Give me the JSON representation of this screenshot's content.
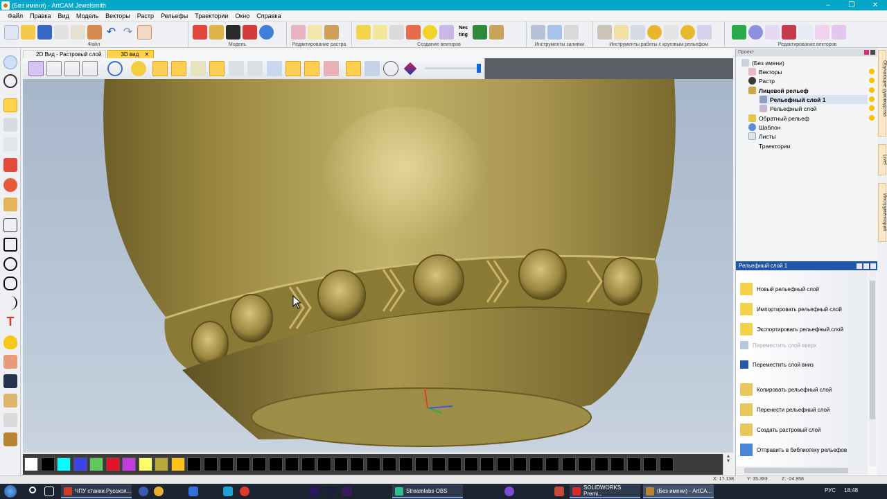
{
  "window": {
    "title": "(Без имени) - ArtCAM Jewelsmith",
    "minimize": "–",
    "maximize": "❐",
    "close": "✕"
  },
  "menu": [
    "Файл",
    "Правка",
    "Вид",
    "Модель",
    "Векторы",
    "Растр",
    "Рельефы",
    "Траектории",
    "Окно",
    "Справка"
  ],
  "ribbon": {
    "groups": [
      "Файл",
      "Модель",
      "Редактирование растра",
      "Создание векторов",
      "Инструменты заливки",
      "Инструменты работы с круговым рельефом",
      "Редактирование векторов"
    ]
  },
  "tabs": {
    "tab_2d": "2D Вид - Растровый слой",
    "tab_3d": "3D вид",
    "close": "✕"
  },
  "project": {
    "header": "Проект",
    "root": "(Без имени)",
    "vectors": "Векторы",
    "raster": "Растр",
    "face_relief": "Лицевой рельеф",
    "relief_layer_1": "Рельефный слой 1",
    "relief_layer": "Рельефный слой",
    "back_relief": "Обратный рельеф",
    "template": "Шаблон",
    "sheets": "Листы",
    "toolpaths": "Траектории"
  },
  "layer_panel": {
    "title": "Рельефный слой 1",
    "items": [
      "Новый рельефный слой",
      "Импортировать рельефный слой",
      "Экспортировать рельефный слой",
      "Переместить слой вверх",
      "Переместить слой вниз",
      "Копировать рельефный слой",
      "Перенести рельефный слой",
      "Создать растровый слой",
      "Отправить в библиотеку рельефов"
    ]
  },
  "side_tabs": [
    "Обучающие руководства",
    "Live!",
    "Инструментарий"
  ],
  "status": {
    "x": "X: 17.138",
    "y": "Y: 35.393",
    "z": "Z: -24.958"
  },
  "palette": [
    "#ffffff",
    "#000000",
    "#00ffff",
    "#3a44e6",
    "#5fc85a",
    "#e0152b",
    "#c43be0",
    "#ffff6a",
    "#b7a93c",
    "#ffc21a",
    "#000000",
    "#000000",
    "#000000",
    "#000000",
    "#000000",
    "#000000",
    "#000000",
    "#000000",
    "#000000",
    "#000000",
    "#000000",
    "#000000",
    "#000000",
    "#000000",
    "#000000",
    "#000000",
    "#000000",
    "#000000",
    "#000000",
    "#000000",
    "#000000",
    "#000000",
    "#000000",
    "#000000",
    "#000000",
    "#000000",
    "#000000",
    "#000000",
    "#000000",
    "#000000"
  ],
  "taskbar": {
    "items": [
      "ЧПУ станки.Русскоя...",
      "Streamlabs OBS",
      "SOLIDWORKS Premi...",
      "(Без имени) - ArtCA..."
    ],
    "lang": "РУС",
    "time": "18:48"
  }
}
